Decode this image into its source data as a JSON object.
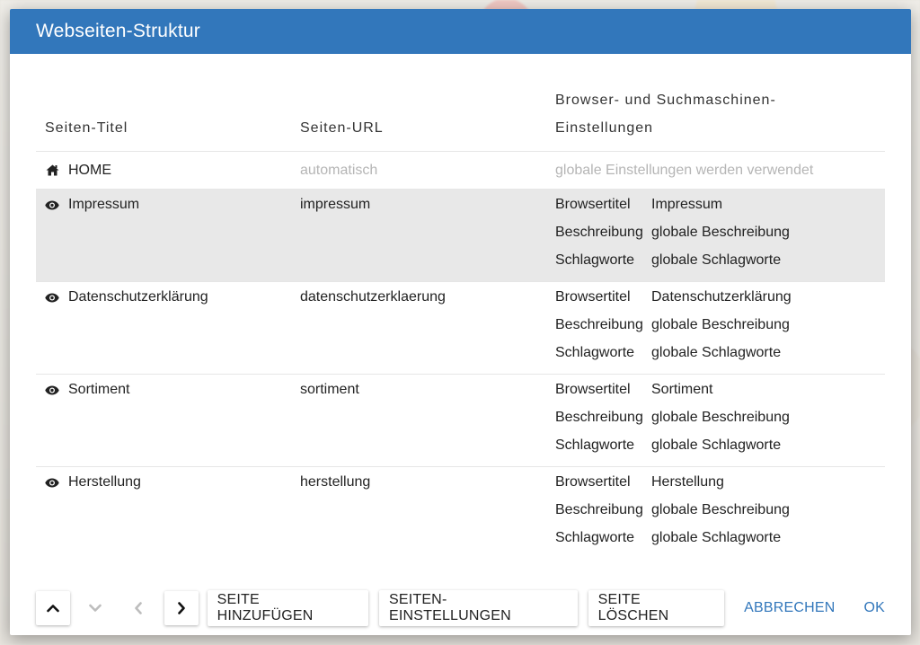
{
  "dialog": {
    "title": "Webseiten-Struktur"
  },
  "columns": {
    "title": "Seiten-Titel",
    "url": "Seiten-URL",
    "settings_line1": "Browser- und Suchmaschinen-",
    "settings_line2": "Einstellungen"
  },
  "home": {
    "title": "HOME",
    "url": "automatisch",
    "settings": "globale Einstellungen werden verwendet"
  },
  "setting_labels": {
    "browser_title": "Browsertitel",
    "description": "Beschreibung",
    "keywords": "Schlagworte"
  },
  "pages": [
    {
      "title": "Impressum",
      "url": "impressum",
      "browser_title": "Impressum",
      "description": "globale Beschreibung",
      "keywords": "globale Schlagworte",
      "selected": true
    },
    {
      "title": "Datenschutzerklärung",
      "url": "datenschutzerklaerung",
      "browser_title": "Datenschutzerklärung",
      "description": "globale Beschreibung",
      "keywords": "globale Schlagworte",
      "selected": false
    },
    {
      "title": "Sortiment",
      "url": "sortiment",
      "browser_title": "Sortiment",
      "description": "globale Beschreibung",
      "keywords": "globale Schlagworte",
      "selected": false
    },
    {
      "title": "Herstellung",
      "url": "herstellung",
      "browser_title": "Herstellung",
      "description": "globale Beschreibung",
      "keywords": "globale Schlagworte",
      "selected": false
    }
  ],
  "footer": {
    "add_page": "SEITE HINZUFÜGEN",
    "page_settings": "SEITEN-EINSTELLUNGEN",
    "delete_page": "SEITE LÖSCHEN",
    "cancel": "ABBRECHEN",
    "ok": "OK"
  },
  "colors": {
    "accent": "#3277bb",
    "selected_row": "#e8e8e8",
    "muted_text": "#b5b5b5"
  },
  "icons": {
    "home": "home-icon",
    "visible": "eye-icon",
    "up": "chevron-up-icon",
    "down": "chevron-down-icon",
    "left": "chevron-left-icon",
    "right": "chevron-right-icon"
  }
}
